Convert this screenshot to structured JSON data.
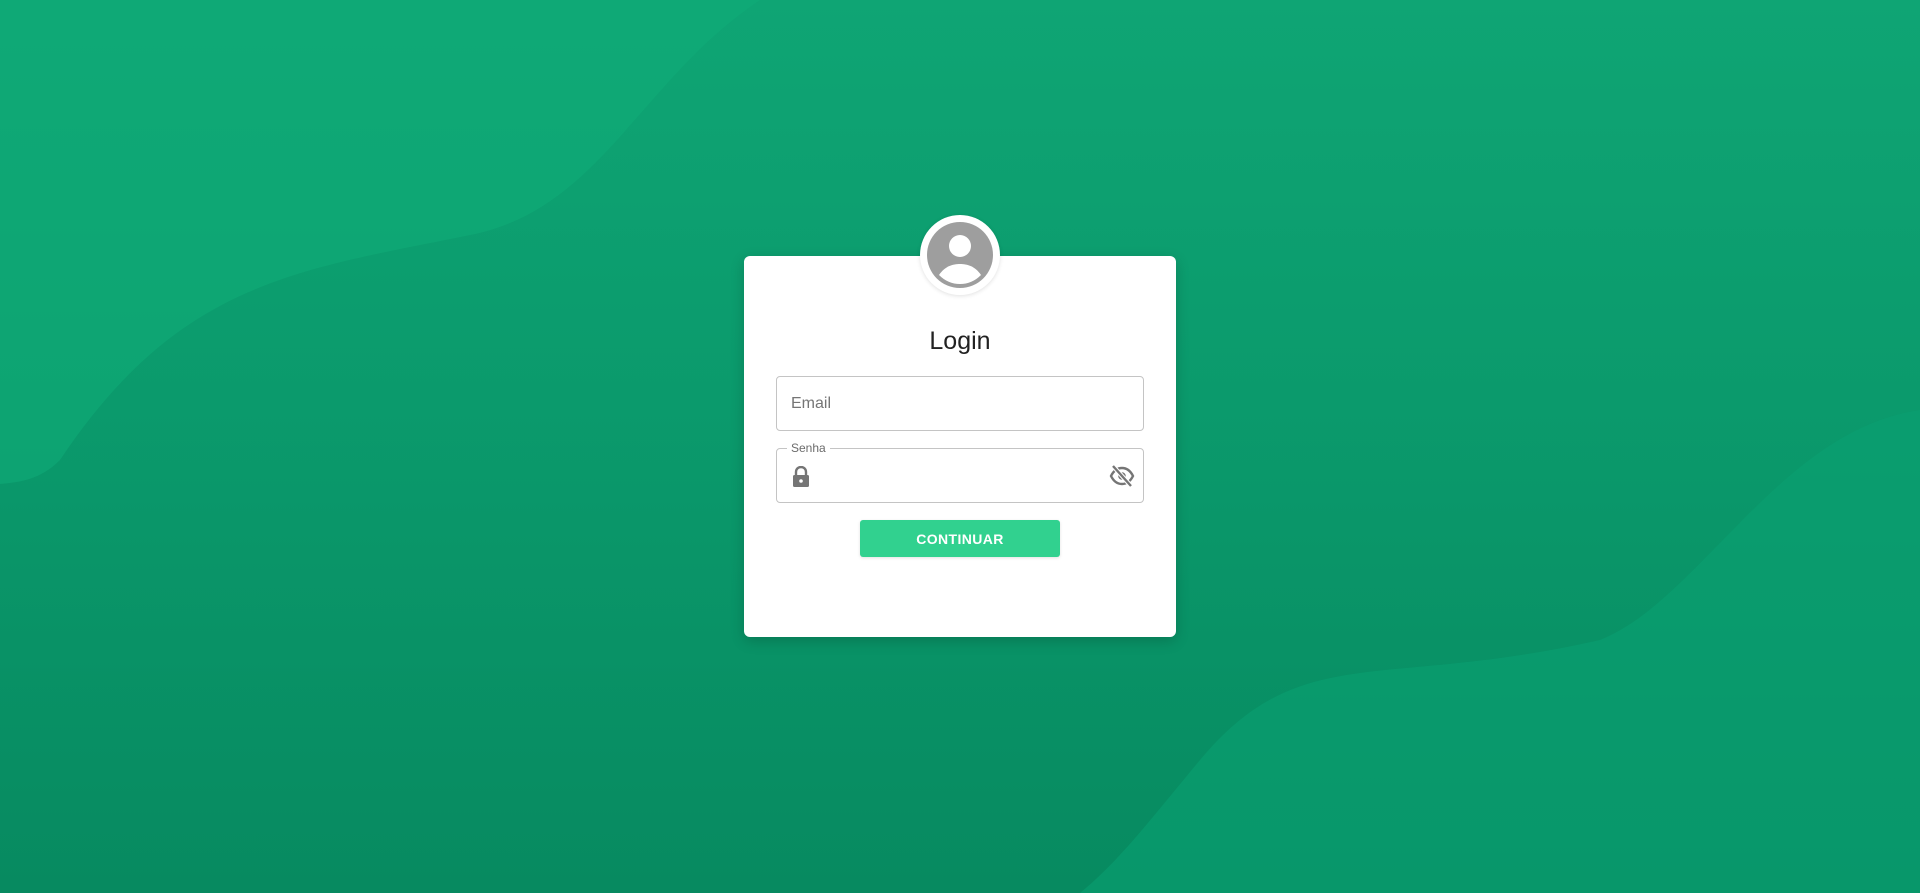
{
  "login": {
    "title": "Login",
    "email": {
      "placeholder": "Email",
      "value": ""
    },
    "password": {
      "label": "Senha",
      "value": ""
    },
    "submit_label": "CONTINUAR"
  },
  "icons": {
    "avatar": "user-avatar-icon",
    "lock": "lock-icon",
    "visibility": "eye-off-icon"
  },
  "colors": {
    "background": "#0b9a6c",
    "button": "#31d18f",
    "card": "#ffffff",
    "icon": "#757575"
  }
}
